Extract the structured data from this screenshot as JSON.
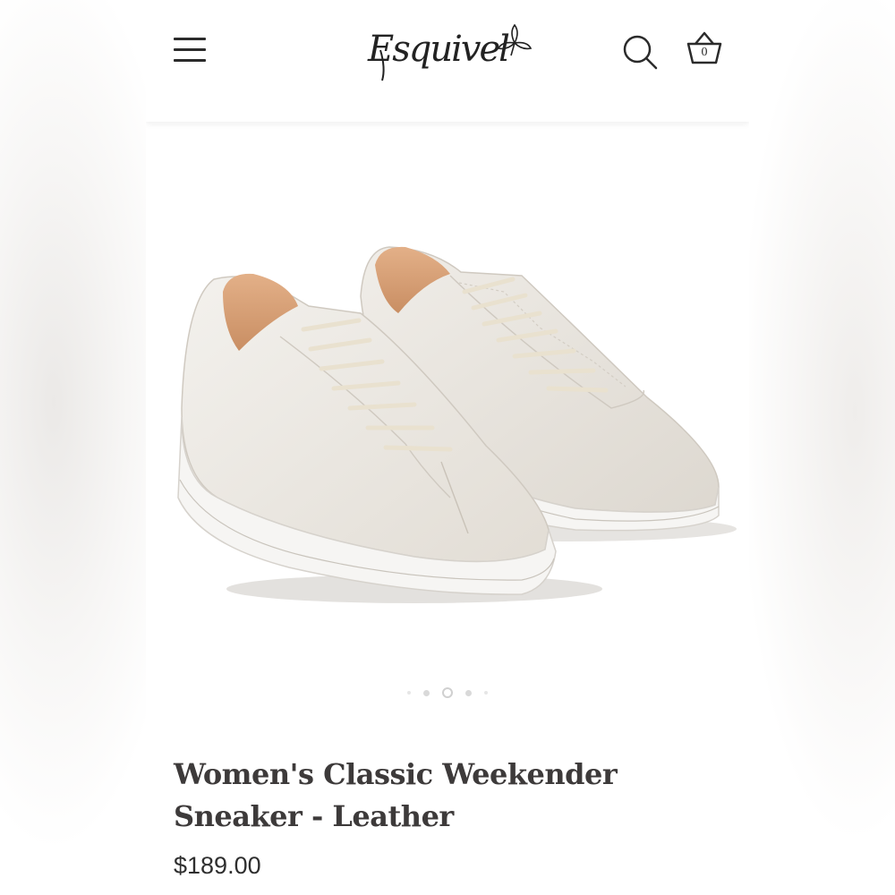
{
  "header": {
    "logo_text": "Esquivel",
    "menu_icon": "hamburger-menu-icon",
    "search_icon": "search-icon",
    "cart_icon": "basket-icon",
    "cart_count": "0"
  },
  "gallery": {
    "image_alt": "Women's Classic Weekender Sneaker - Leather, cream leather pair",
    "slide_count": 5,
    "active_slide": 3
  },
  "product": {
    "title": "Women's Classic Weekender Sneaker - Leather",
    "price": "$189.00"
  },
  "colors": {
    "text": "#3d3a3a",
    "leather": "#ece8e2",
    "sole": "#f4f3f1",
    "lining": "#d9a478"
  }
}
